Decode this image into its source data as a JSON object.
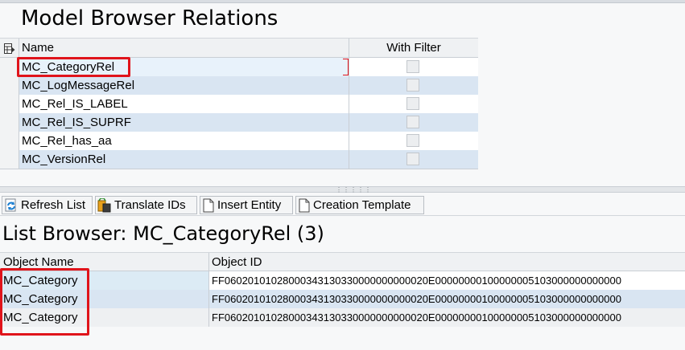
{
  "relations_panel": {
    "title": "Model Browser Relations",
    "columns": {
      "name": "Name",
      "with_filter": "With Filter"
    },
    "rows": [
      {
        "name": "MC_CategoryRel",
        "with_filter": false
      },
      {
        "name": "MC_LogMessageRel",
        "with_filter": false
      },
      {
        "name": "MC_Rel_IS_LABEL",
        "with_filter": false
      },
      {
        "name": "MC_Rel_IS_SUPRF",
        "with_filter": false
      },
      {
        "name": "MC_Rel_has_aa",
        "with_filter": false
      },
      {
        "name": "MC_VersionRel",
        "with_filter": false
      }
    ]
  },
  "toolbar": {
    "refresh_label": "Refresh List",
    "translate_label": "Translate IDs",
    "insert_label": "Insert Entity",
    "template_label": "Creation Template"
  },
  "list_browser": {
    "title": "List Browser: MC_CategoryRel (3)",
    "columns": {
      "object_name": "Object Name",
      "object_id": "Object ID"
    },
    "rows": [
      {
        "object_name": "MC_Category",
        "object_id": "FF06020101028000343130330000000000020E00000000100000005103000000000000"
      },
      {
        "object_name": "MC_Category",
        "object_id": "FF06020101028000343130330000000000020E00000000100000005103000000000000"
      },
      {
        "object_name": "MC_Category",
        "object_id": "FF06020101028000343130330000000000020E00000000100000005103000000000000"
      }
    ]
  },
  "colors": {
    "highlight_red": "#e0141b",
    "row_blue": "#d9e5f2"
  }
}
